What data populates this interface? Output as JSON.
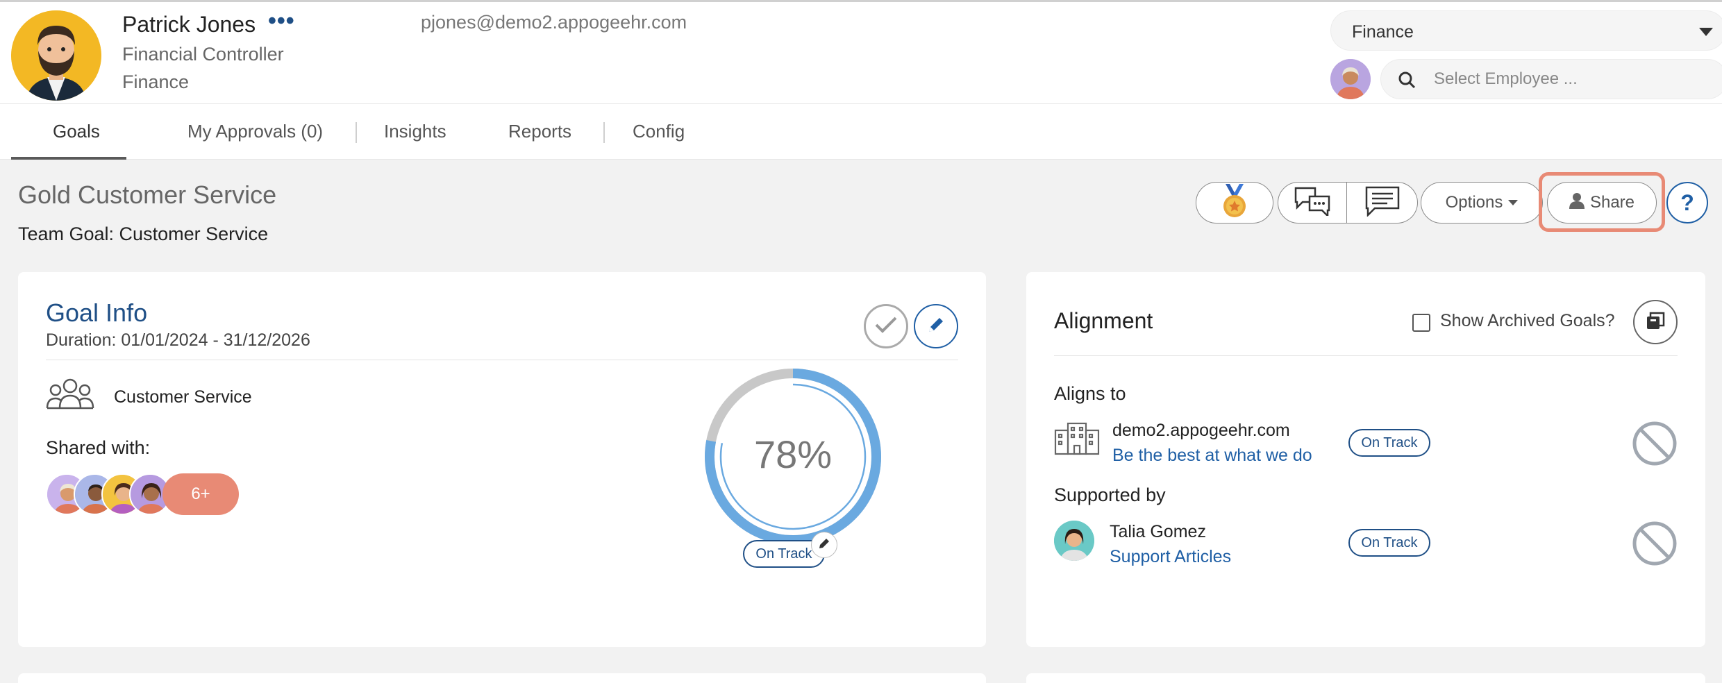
{
  "user": {
    "name": "Patrick Jones",
    "more": "•••",
    "title": "Financial Controller",
    "department": "Finance",
    "email": "pjones@demo2.appogeehr.com"
  },
  "department_select": {
    "value": "Finance"
  },
  "employee_search": {
    "placeholder": "Select Employee ..."
  },
  "tabs": [
    {
      "label": "Goals",
      "active": true
    },
    {
      "label": "My Approvals (0)"
    },
    {
      "label": "Insights"
    },
    {
      "label": "Reports"
    },
    {
      "label": "Config"
    }
  ],
  "page": {
    "title": "Gold Customer Service",
    "subtitle": "Team Goal: Customer Service"
  },
  "toolbar": {
    "options_label": "Options",
    "share_label": "Share",
    "help_label": "?"
  },
  "goal_info": {
    "title": "Goal Info",
    "duration": "Duration: 01/01/2024 - 31/12/2026",
    "team": "Customer Service",
    "shared_with_label": "Shared with:",
    "shared_more": "6+",
    "progress": 78,
    "progress_label": "78%",
    "status": "On Track"
  },
  "alignment": {
    "title": "Alignment",
    "archived_label": "Show Archived Goals?",
    "aligns_to_label": "Aligns to",
    "aligns_to": {
      "owner": "demo2.appogeehr.com",
      "goal": "Be the best at what we do",
      "status": "On Track"
    },
    "supported_by_label": "Supported by",
    "supported_by": {
      "owner": "Talia Gomez",
      "goal": "Support Articles",
      "status": "On Track"
    }
  },
  "colors": {
    "accent": "#1f4f86",
    "link": "#1f5fa5",
    "progress": "#6aa9e0",
    "progress_track": "#c8c8c8",
    "highlight": "#e88a75"
  }
}
